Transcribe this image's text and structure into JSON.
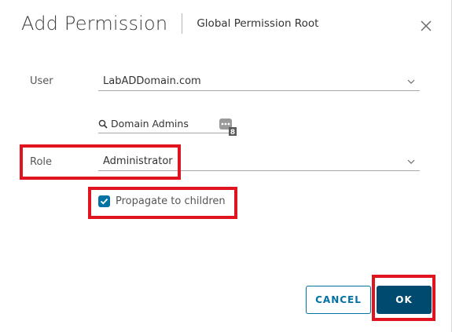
{
  "dialog": {
    "title": "Add Permission",
    "subtitle": "Global Permission Root"
  },
  "user": {
    "label": "User",
    "domain": "LabADDomain.com",
    "search_value": "Domain Admins",
    "browse_badge": "8"
  },
  "role": {
    "label": "Role",
    "value": "Administrator"
  },
  "propagate": {
    "label": "Propagate to children",
    "checked": true
  },
  "buttons": {
    "cancel": "CANCEL",
    "ok": "OK"
  },
  "colors": {
    "primary": "#0072a3",
    "primary_dark": "#004a70",
    "highlight": "#e0141e"
  }
}
